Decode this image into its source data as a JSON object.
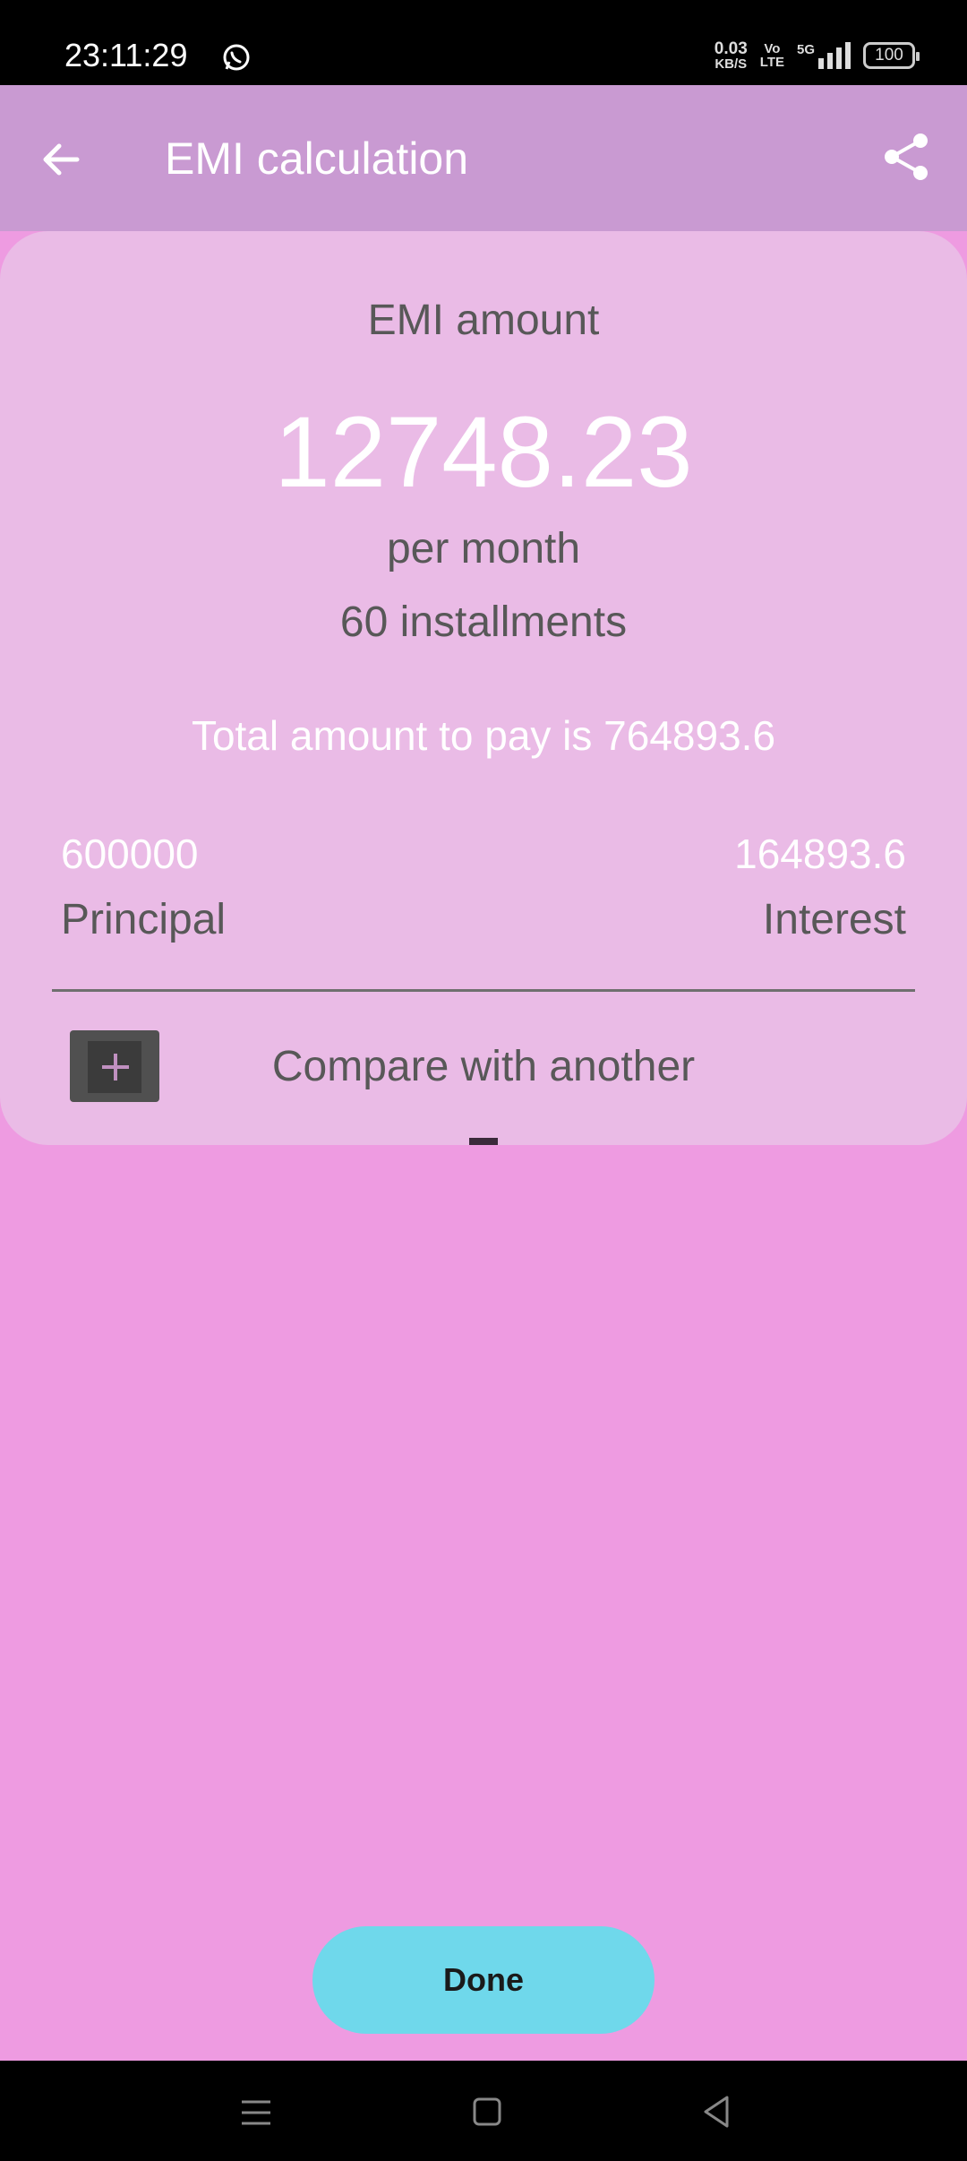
{
  "status_bar": {
    "time": "23:11:29",
    "speed_value": "0.03",
    "speed_unit": "KB/S",
    "volte_top": "Vo",
    "volte_bottom": "LTE",
    "network": "5G",
    "battery": "100"
  },
  "app_bar": {
    "title": "EMI calculation"
  },
  "result": {
    "emi_label": "EMI amount",
    "emi_value": "12748.23",
    "per_month": "per month",
    "installments": "60 installments",
    "total_text": "Total amount to pay is 764893.6",
    "principal_value": "600000",
    "principal_label": "Principal",
    "interest_value": "164893.6",
    "interest_label": "Interest",
    "compare_label": "Compare with another"
  },
  "actions": {
    "done_label": "Done"
  },
  "colors": {
    "background": "#ee9be1",
    "app_bar": "#c99ad2",
    "card": "#eabbe6",
    "done_button": "#6fd8eb"
  }
}
